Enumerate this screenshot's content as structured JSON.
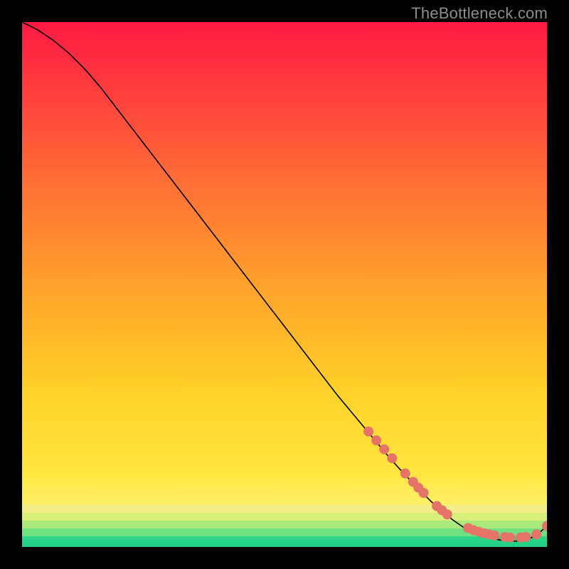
{
  "watermark": "TheBottleneck.com",
  "chart_data": {
    "type": "line",
    "title": "",
    "xlabel": "",
    "ylabel": "",
    "xlim": [
      0,
      100
    ],
    "ylim": [
      0,
      100
    ],
    "grid": false,
    "legend": false,
    "background_gradient": {
      "top_color": "#ff1a43",
      "mid_color": "#ffd625",
      "bottom_band_colors": [
        "#f6ee8a",
        "#d8ef7a",
        "#9fe97c",
        "#47db86",
        "#1ed084"
      ],
      "bottom_band_start": 92
    },
    "series": [
      {
        "name": "bottleneck-curve",
        "color": "#000000",
        "width": 1.6,
        "x": [
          0,
          3,
          6,
          9,
          12,
          15,
          20,
          25,
          30,
          35,
          40,
          45,
          50,
          55,
          60,
          65,
          70,
          72,
          75,
          78,
          80,
          82,
          84,
          86,
          88,
          90,
          92,
          94,
          96,
          98,
          100
        ],
        "y": [
          100,
          98.5,
          96.5,
          94,
          91,
          87.5,
          81,
          74.5,
          68,
          61.5,
          55,
          48.5,
          42,
          35.5,
          29,
          23,
          17,
          14.8,
          11.6,
          8.6,
          6.8,
          5.2,
          3.8,
          2.8,
          2.0,
          1.5,
          1.2,
          1.1,
          1.3,
          2.2,
          4.0
        ]
      }
    ],
    "markers": {
      "name": "highlight-points",
      "color": "#e57368",
      "radius": 7,
      "x": [
        66,
        67.5,
        69,
        70.5,
        73,
        74.5,
        75.5,
        76.5,
        79,
        80,
        81,
        85,
        86,
        87,
        88,
        89,
        90,
        92,
        93,
        95,
        96,
        98,
        100
      ],
      "y": [
        22.0,
        20.3,
        18.6,
        16.9,
        14.0,
        12.4,
        11.3,
        10.3,
        7.8,
        7.0,
        6.2,
        3.6,
        3.2,
        2.9,
        2.6,
        2.4,
        2.2,
        1.9,
        1.8,
        1.8,
        1.9,
        2.4,
        4.0
      ]
    }
  }
}
